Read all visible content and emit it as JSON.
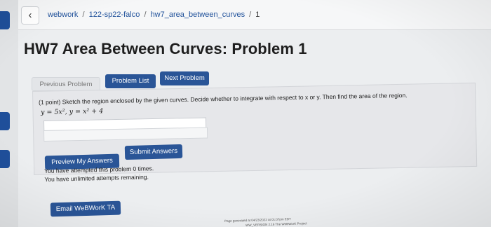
{
  "nav": {
    "back_icon": "chevron-left-icon",
    "back_glyph": "‹",
    "breadcrumb": [
      {
        "label": "webwork"
      },
      {
        "label": "122-sp22-falco"
      },
      {
        "label": "hw7_area_between_curves"
      },
      {
        "label": "1"
      }
    ],
    "separator": "/"
  },
  "page": {
    "title": "HW7 Area Between Curves: Problem 1"
  },
  "problem_nav": {
    "previous_label": "Previous Problem",
    "list_label": "Problem List",
    "next_label": "Next Problem"
  },
  "problem": {
    "statement": "(1 point) Sketch the region enclosed by the given curves. Decide whether to integrate with respect to x or y. Then find the area of the region.",
    "equation": "y = 5x², y = x² + 4",
    "answer_value": ""
  },
  "actions": {
    "preview_label": "Preview My Answers",
    "submit_label": "Submit Answers"
  },
  "attempts": {
    "line1": "You have attempted this problem 0 times.",
    "line2": "You have unlimited attempts remaining."
  },
  "email": {
    "label": "Email WeBWorK TA"
  },
  "footer": {
    "line1": "Page generated at 04/23/2022 at 01:07pm EDT",
    "line2": "WW_VERSION 2.16  The WeBWorK Project"
  },
  "colors": {
    "primary_button": "#2a5597",
    "link": "#1d4f99",
    "disabled_button": "#e3e5e8",
    "accent_block": "#1f4f9a"
  }
}
